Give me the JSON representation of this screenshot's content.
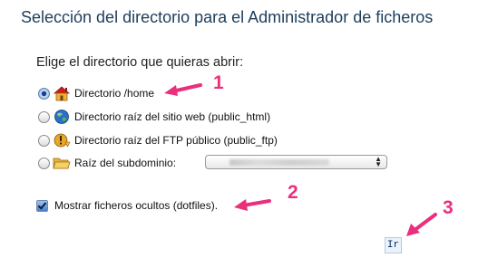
{
  "page": {
    "title": "Selección del directorio para el Administrador de ficheros",
    "subtitle": "Elige el directorio que quieras abrir:"
  },
  "options": [
    {
      "label": "Directorio /home",
      "icon": "home-icon",
      "selected": true
    },
    {
      "label": "Directorio raíz del sitio web (public_html)",
      "icon": "globe-icon",
      "selected": false
    },
    {
      "label": "Directorio raíz del FTP público (public_ftp)",
      "icon": "ftp-warning-icon",
      "selected": false
    },
    {
      "label": "Raíz del subdominio:",
      "icon": "folder-icon",
      "selected": false
    }
  ],
  "subdomain_select": {
    "value": ""
  },
  "show_hidden": {
    "label": "Mostrar ficheros ocultos (dotfiles).",
    "checked": true
  },
  "go_button": {
    "label": "Ir"
  },
  "annotations": [
    {
      "number": "1"
    },
    {
      "number": "2"
    },
    {
      "number": "3"
    }
  ],
  "colors": {
    "title": "#1c3d5c",
    "annotation": "#ea2f7c",
    "button_text": "#0b2a66"
  }
}
